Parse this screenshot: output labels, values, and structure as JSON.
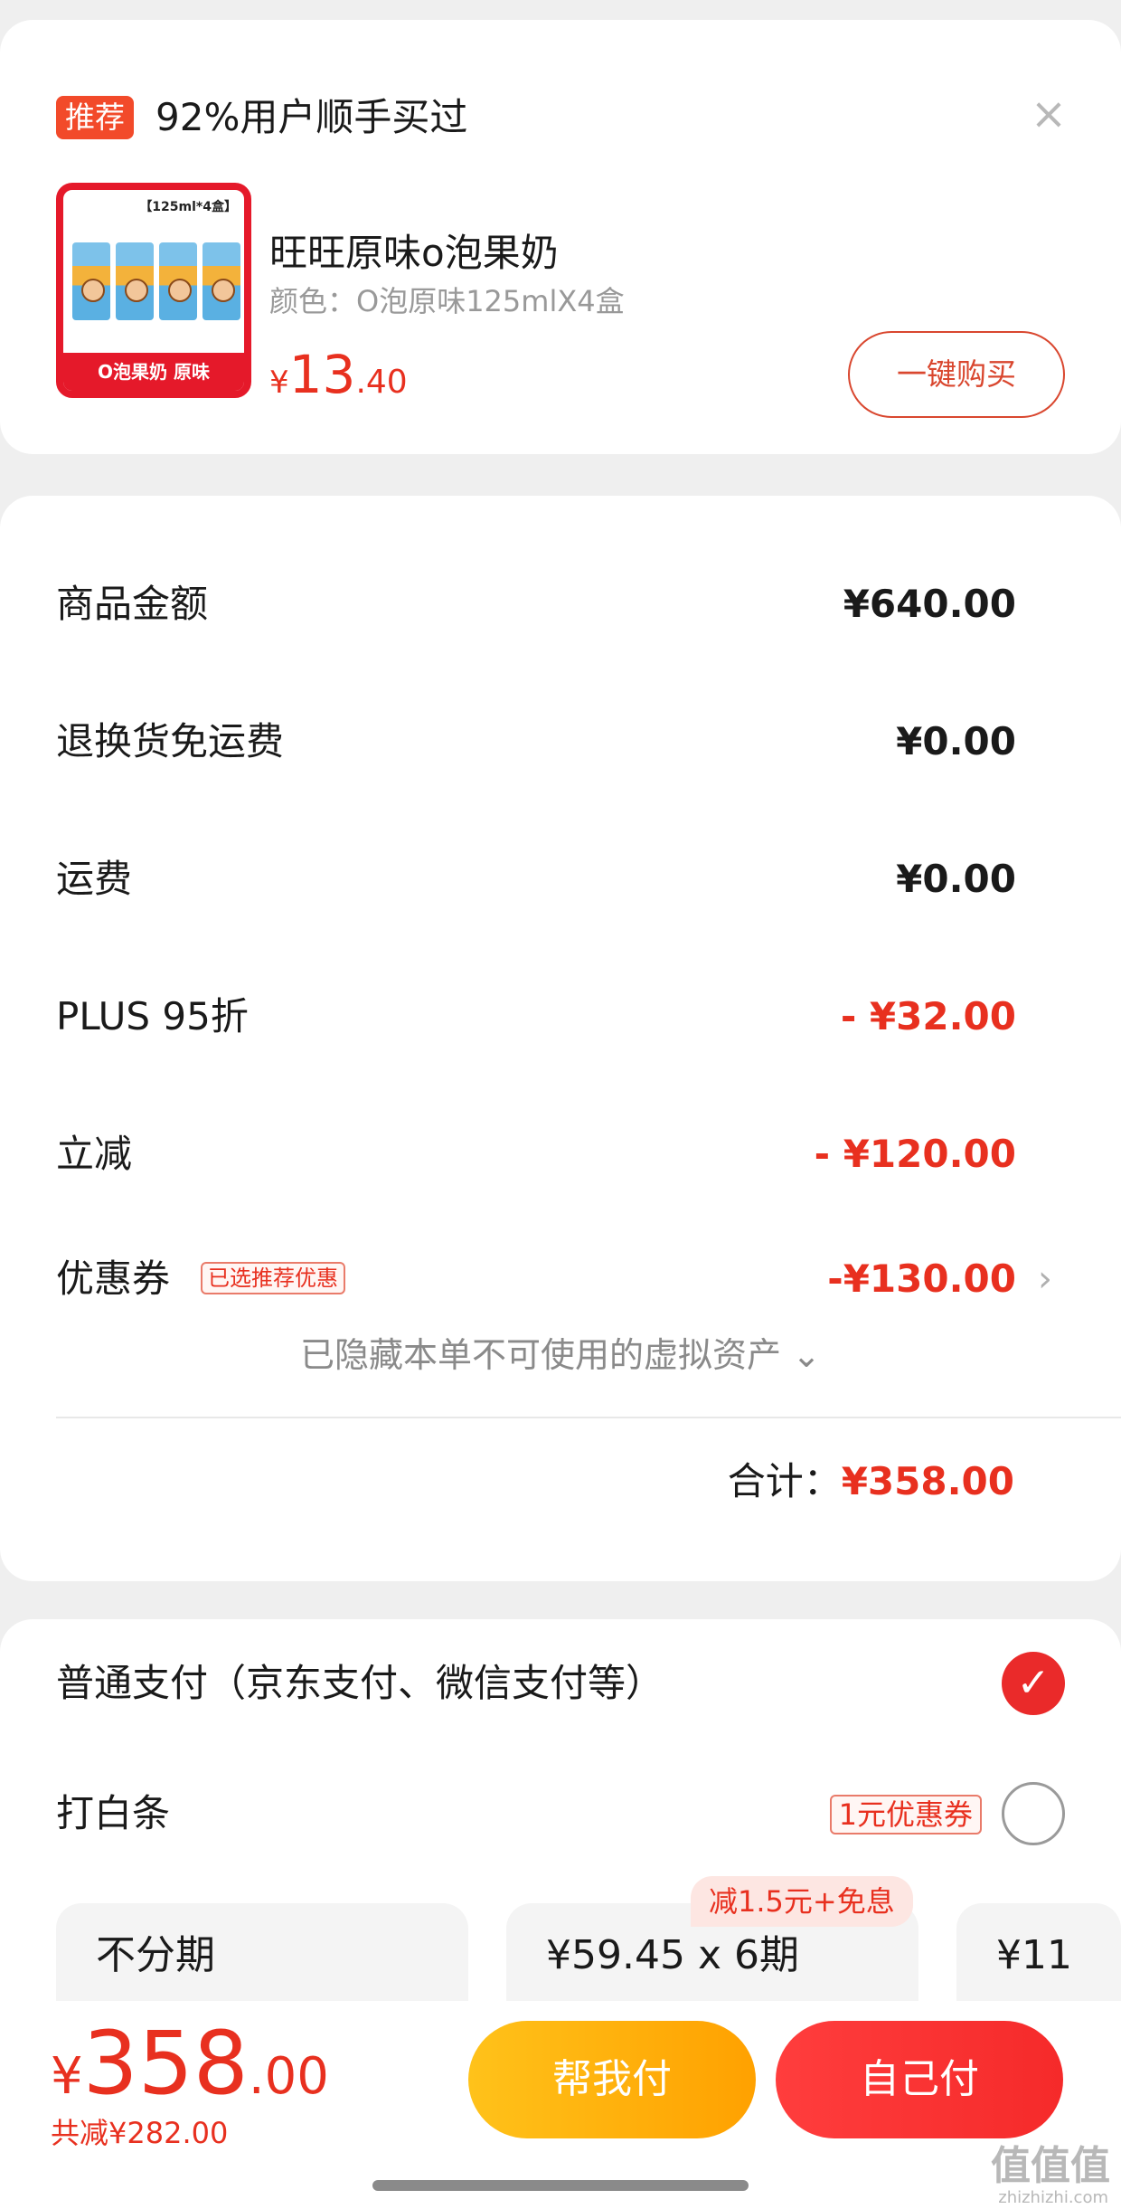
{
  "recommend": {
    "badge": "推荐",
    "title": "92%用户顺手买过",
    "close_icon": "close-icon",
    "thumb_top_text": "【125ml*4盒】",
    "thumb_bottom_text": "O泡果奶 原味",
    "product_name": "旺旺原味o泡果奶",
    "product_spec": "颜色：O泡原味125mlX4盒",
    "price_symbol": "¥",
    "price_int": "13",
    "price_dec": ".40",
    "buy_label": "一键购买"
  },
  "summary": {
    "rows": [
      {
        "label": "商品金额",
        "value": "¥640.00"
      },
      {
        "label": "退换货免运费",
        "value": "¥0.00"
      },
      {
        "label": "运费",
        "value": "¥0.00"
      },
      {
        "label": "PLUS 95折",
        "value": "- ¥32.00"
      },
      {
        "label": "立减",
        "value": "- ¥120.00"
      },
      {
        "label": "优惠券",
        "value": "-¥130.00",
        "tag": "已选推荐优惠"
      }
    ],
    "hidden_note": "已隐藏本单不可使用的虚拟资产 ⌄",
    "total_label": "合计：",
    "total_value": "¥358.00"
  },
  "payment": {
    "normal_label": "普通支付（京东支付、微信支付等）",
    "baitiao_label": "打白条",
    "baitiao_coupon": "1元优惠券",
    "installments": [
      {
        "text": "不分期"
      },
      {
        "text": "¥59.45 x 6期",
        "tag": "减1.5元+免息"
      },
      {
        "text": "¥11"
      }
    ]
  },
  "bottom": {
    "price_symbol": "¥",
    "price_int": "358",
    "price_dec": ".00",
    "saved": "共减¥282.00",
    "help_pay": "帮我付",
    "self_pay": "自己付"
  },
  "watermark": {
    "main": "值值值",
    "sub": "zhizhizhi.com"
  },
  "colors": {
    "accent_red": "#e8301f",
    "yellow": "#ffb400",
    "card_bg": "#ffffff",
    "page_bg": "#efefef"
  }
}
